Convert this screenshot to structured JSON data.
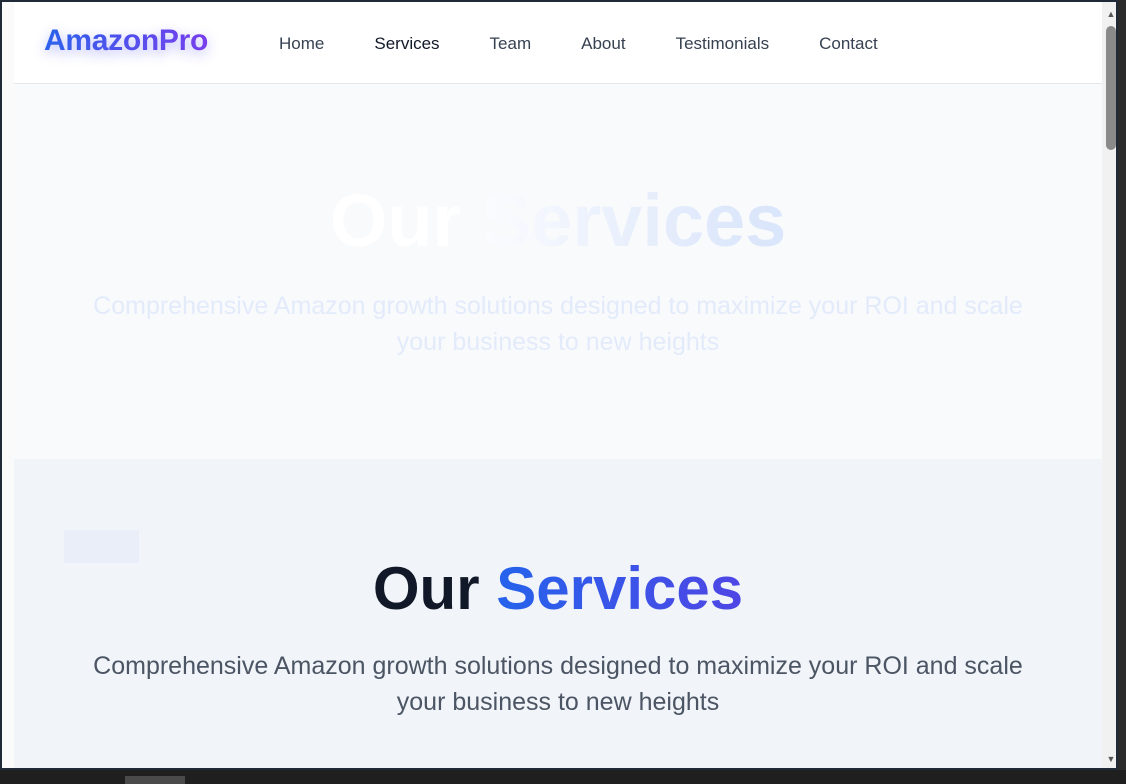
{
  "nav": {
    "logo": "AmazonPro",
    "links": [
      "Home",
      "Services",
      "Team",
      "About",
      "Testimonials",
      "Contact"
    ]
  },
  "hero": {
    "title": "Our Services",
    "subtitle": "Comprehensive Amazon growth solutions designed to maximize your ROI and scale your business to new heights"
  },
  "services": {
    "title_prefix": "Our",
    "title_accent": "Services",
    "subtitle": "Comprehensive Amazon growth solutions designed to maximize your ROI and scale your business to new heights"
  },
  "colors": {
    "brand_blue": "#2563eb",
    "brand_purple": "#7c3aed",
    "heading_dark": "#111827",
    "text_gray": "#4b5563"
  },
  "icons": {
    "scroll_up": "triangle-up-icon",
    "scroll_down": "triangle-down-icon"
  }
}
